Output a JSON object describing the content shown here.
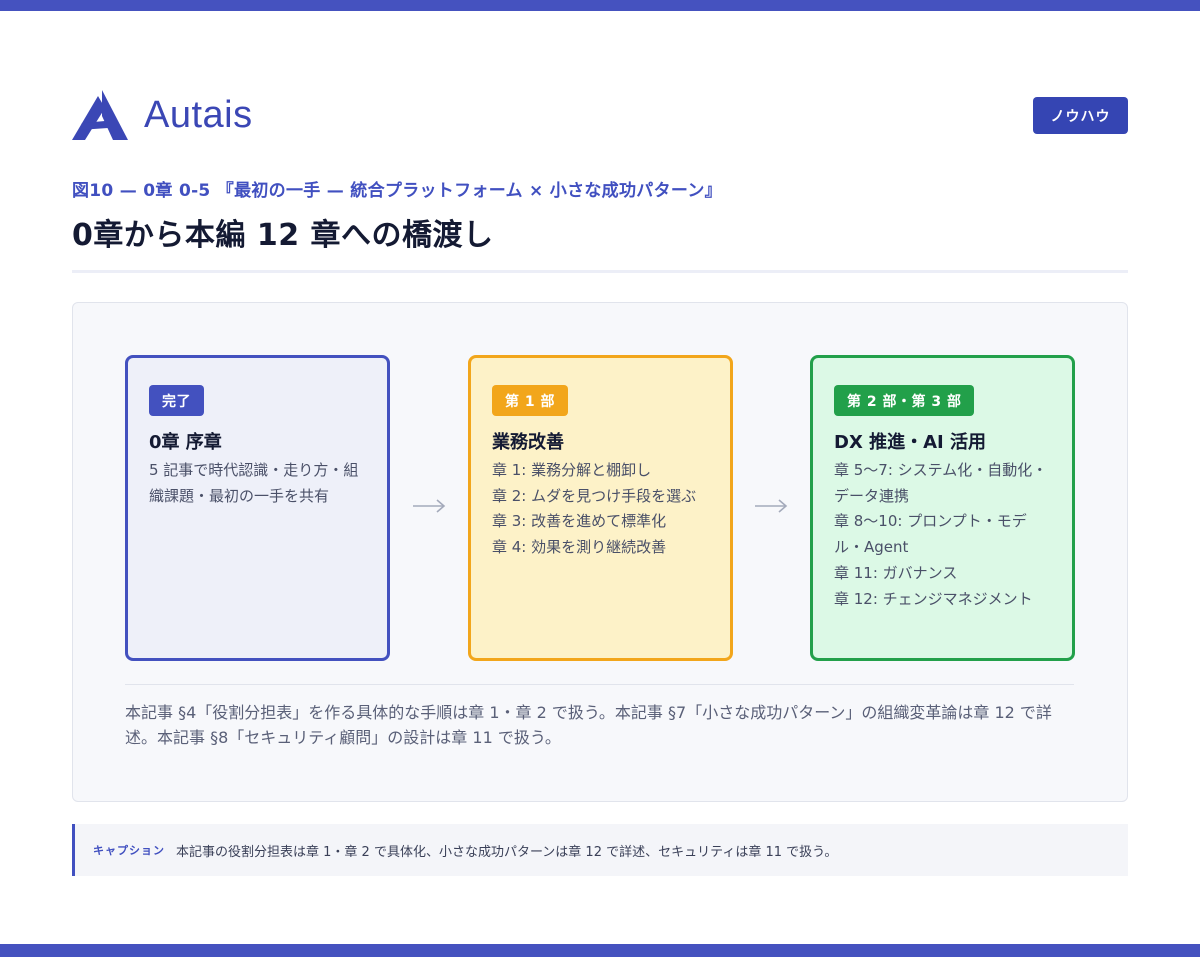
{
  "brand": {
    "name": "Autais",
    "color": "#3b47b5"
  },
  "header_badge": "ノウハウ",
  "figure_label": "図10 — 0章 0-5 『最初の一手 — 統合プラットフォーム × 小さな成功パターン』",
  "title": "0章から本編 12 章への橋渡し",
  "cards": [
    {
      "tag": "完了",
      "title": "0章 序章",
      "lines": [
        "5 記事で時代認識・走り方・組織課題・最初の一手を共有"
      ],
      "accent": "#4351bf",
      "fill": "#eef0f9"
    },
    {
      "tag": "第 1 部",
      "title": "業務改善",
      "lines": [
        "章 1: 業務分解と棚卸し",
        "章 2: ムダを見つけ手段を選ぶ",
        "章 3: 改善を進めて標準化",
        "章 4: 効果を測り継続改善"
      ],
      "accent": "#f2a61b",
      "fill": "#fdf2c8"
    },
    {
      "tag": "第 2 部・第 3 部",
      "title": "DX 推進・AI 活用",
      "lines": [
        "章 5〜7: システム化・自動化・データ連携",
        "章 8〜10: プロンプト・モデル・Agent",
        "章 11: ガバナンス",
        "章 12: チェンジマネジメント"
      ],
      "accent": "#22a04a",
      "fill": "#dcf9e6"
    }
  ],
  "arrow_icon": "arrow-right-icon",
  "note": "本記事 §4「役割分担表」を作る具体的な手順は章 1・章 2 で扱う。本記事 §7「小さな成功パターン」の組織変革論は章 12 で詳述。本記事 §8「セキュリティ顧問」の設計は章 11 で扱う。",
  "caption": {
    "label": "キャプション",
    "text": "本記事の役割分担表は章 1・章 2 で具体化、小さな成功パターンは章 12 で詳述、セキュリティは章 11 で扱う。"
  }
}
